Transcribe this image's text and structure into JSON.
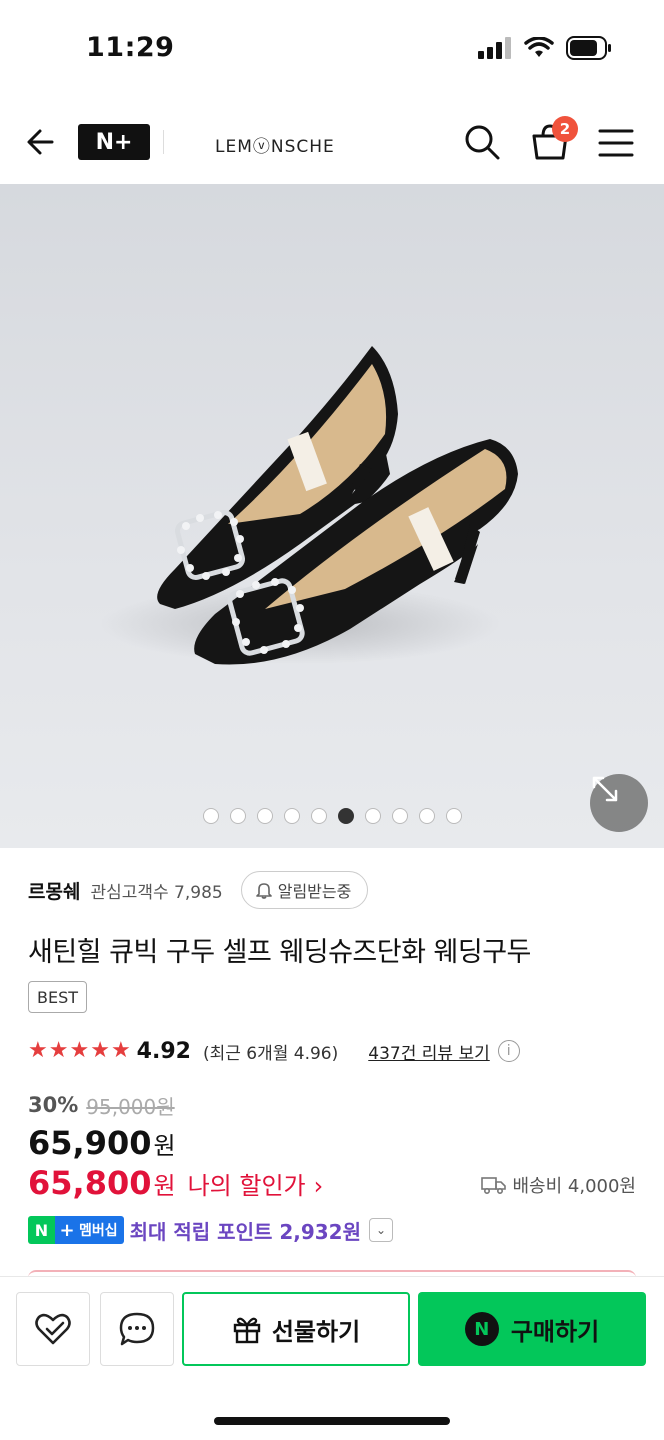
{
  "status_bar": {
    "time": "11:29"
  },
  "header": {
    "nplus_label": "N+",
    "brand": "LEMⓥNSCHE",
    "cart_count": "2"
  },
  "gallery": {
    "total_images": 10,
    "active_index": 5
  },
  "store": {
    "name": "르몽쉐",
    "followers": "관심고객수 7,985",
    "notify_label": "알림받는중"
  },
  "product": {
    "title": "새틴힐 큐빅 구두 셀프 웨딩슈즈단화 웨딩구두",
    "badge": "BEST"
  },
  "rating": {
    "stars": 5,
    "score": "4.92",
    "recent": "(최근 6개월 4.96)",
    "reviews_link": "437건 리뷰 보기",
    "info_glyph": "i"
  },
  "pricing": {
    "discount": "30%",
    "original_price": "95,000원",
    "price": "65,900",
    "price_unit": "원",
    "my_price": "65,800",
    "my_price_unit": "원",
    "my_price_label": "나의 할인가",
    "my_price_chevron": "›",
    "shipping": "배송비 4,000원"
  },
  "membership": {
    "badge_n": "N",
    "badge_plus": "+",
    "badge_text": "멤버십",
    "max_points": "최대 적립 포인트 2,932원",
    "chevron": "⌄"
  },
  "actions": {
    "gift_label": "선물하기",
    "buy_label": "구매하기",
    "buy_badge": "N"
  },
  "colors": {
    "naver_green": "#03c75a",
    "sale_red": "#e1123a",
    "points_purple": "#6b46c1",
    "star_red": "#e53e3e"
  }
}
